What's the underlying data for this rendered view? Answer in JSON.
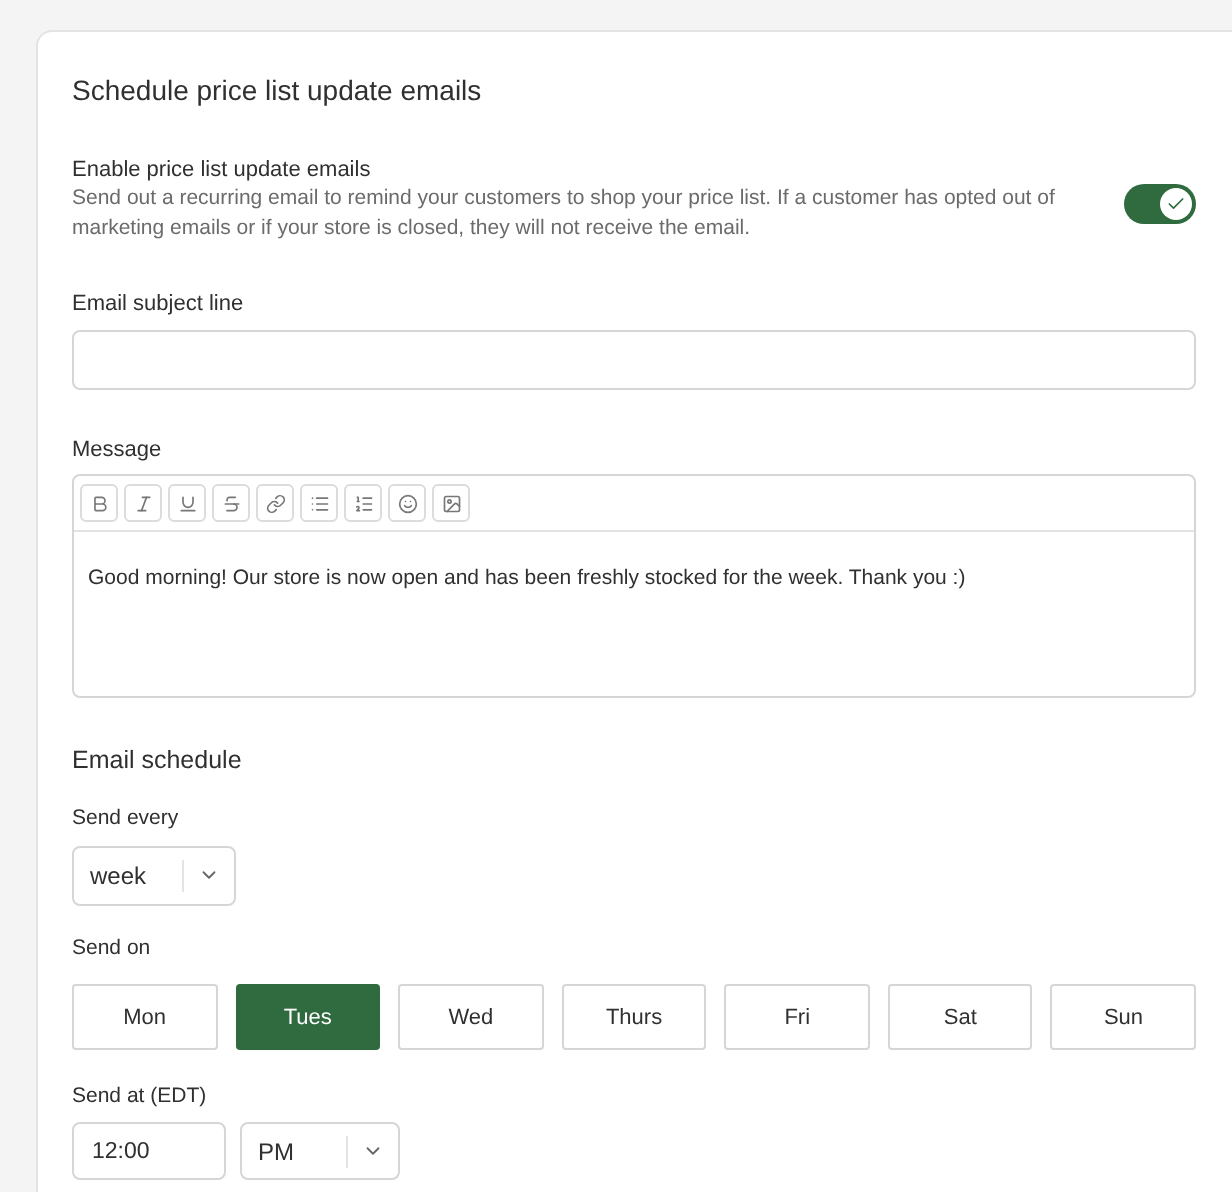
{
  "title": "Schedule price list update emails",
  "enable": {
    "label": "Enable price list update emails",
    "description": "Send out a recurring email to remind your customers to shop your price list. If a customer has opted out of marketing emails or if your store is closed, they will not receive the email.",
    "on": true
  },
  "subject": {
    "label": "Email subject line"
  },
  "message": {
    "label": "Message",
    "toolbar": [
      {
        "kind": "bold"
      },
      {
        "kind": "italic"
      },
      {
        "kind": "underline"
      },
      {
        "kind": "strike"
      },
      {
        "kind": "link"
      },
      {
        "kind": "bullets"
      },
      {
        "kind": "numbered"
      },
      {
        "kind": "emoji"
      },
      {
        "kind": "image"
      }
    ],
    "value": "Good morning! Our store is now open and has been freshly stocked for the week. Thank you :)"
  },
  "schedule": {
    "title": "Email schedule",
    "send_every": {
      "label": "Send every",
      "value": "week"
    },
    "send_on": {
      "label": "Send on",
      "days": [
        {
          "label": "Mon",
          "selected": false
        },
        {
          "label": "Tues",
          "selected": true
        },
        {
          "label": "Wed",
          "selected": false
        },
        {
          "label": "Thurs",
          "selected": false
        },
        {
          "label": "Fri",
          "selected": false
        },
        {
          "label": "Sat",
          "selected": false
        },
        {
          "label": "Sun",
          "selected": false
        }
      ]
    },
    "send_at": {
      "label": "Send at (EDT)",
      "time": "12:00",
      "period": "PM"
    }
  }
}
